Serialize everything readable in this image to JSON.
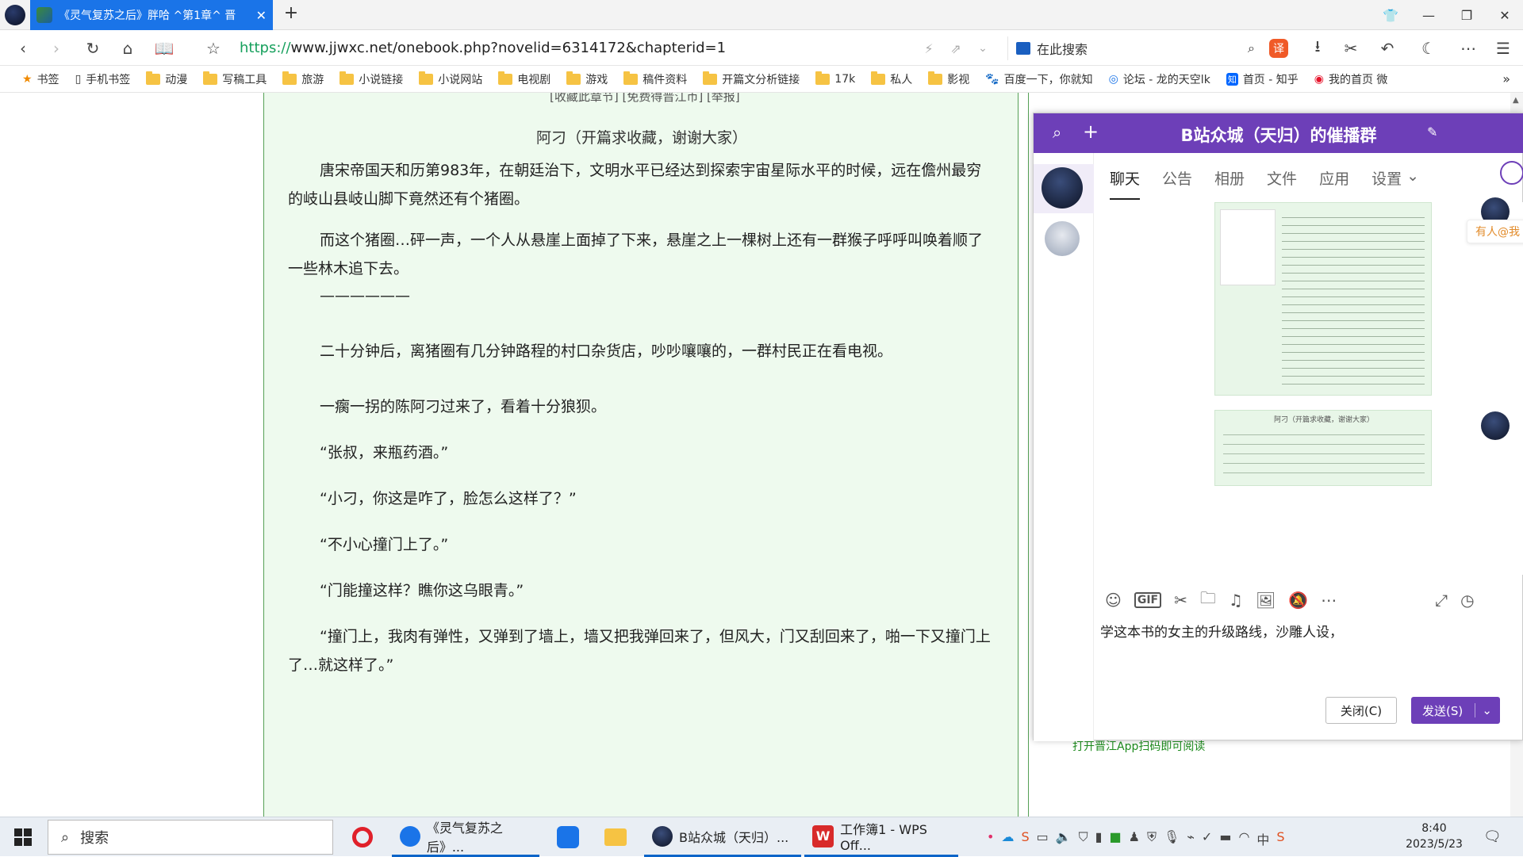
{
  "browser": {
    "tab_title": "《灵气复苏之后》胖哈  ^第1章^ 晋",
    "new_tab": "+",
    "url_https": "https://",
    "url_rest": "www.jjwxc.net/onebook.php?novelid=6314172&chapterid=1",
    "search_placeholder": "在此搜索"
  },
  "bookmarks": [
    {
      "label": "书签",
      "icon": "star-icon"
    },
    {
      "label": "手机书签",
      "icon": "phone-icon"
    },
    {
      "label": "动漫",
      "icon": "folder-icon"
    },
    {
      "label": "写稿工具",
      "icon": "folder-icon"
    },
    {
      "label": "旅游",
      "icon": "folder-icon"
    },
    {
      "label": "小说链接",
      "icon": "folder-icon"
    },
    {
      "label": "小说网站",
      "icon": "folder-icon"
    },
    {
      "label": "电视剧",
      "icon": "folder-icon"
    },
    {
      "label": "游戏",
      "icon": "folder-icon"
    },
    {
      "label": "稿件资料",
      "icon": "folder-icon"
    },
    {
      "label": "开篇文分析链接",
      "icon": "folder-icon"
    },
    {
      "label": "17k",
      "icon": "folder-icon"
    },
    {
      "label": "私人",
      "icon": "folder-icon"
    },
    {
      "label": "影视",
      "icon": "folder-icon"
    },
    {
      "label": "百度一下，你就知",
      "icon": "baidu-icon"
    },
    {
      "label": "论坛 - 龙的天空lk",
      "icon": "forum-icon"
    },
    {
      "label": "首页 - 知乎",
      "icon": "zhihu-icon"
    },
    {
      "label": "我的首页 微",
      "icon": "weibo-icon"
    }
  ],
  "article": {
    "top_links": "[收藏此章节] [免费得晋江币] [举报]",
    "title": "阿刁（开篇求收藏，谢谢大家）",
    "paragraphs": [
      "唐宋帝国天和历第983年，在朝廷治下，文明水平已经达到探索宇宙星际水平的时候，远在儋州最穷的岐山县岐山脚下竟然还有个猪圈。",
      "而这个猪圈…砰一声，一个人从悬崖上面掉了下来，悬崖之上一棵树上还有一群猴子呼呼叫唤着顺了一些林木追下去。",
      "——————",
      "二十分钟后，离猪圈有几分钟路程的村口杂货店，吵吵嚷嚷的，一群村民正在看电视。",
      "一瘸一拐的陈阿刁过来了，看着十分狼狈。",
      "“张叔，来瓶药酒。”",
      "“小刁，你这是咋了，脸怎么这样了？”",
      "“不小心撞门上了。”",
      "“门能撞这样？瞧你这乌眼青。”",
      "“撞门上，我肉有弹性，又弹到了墙上，墙又把我弹回来了，但风大，门又刮回来了，啪一下又撞门上了…就这样了。”"
    ],
    "side_text": "打开晋江App扫码即可阅读"
  },
  "chat": {
    "title": "B站众城（天归）的催播群",
    "tabs": [
      "聊天",
      "公告",
      "相册",
      "文件",
      "应用",
      "设置"
    ],
    "at_me": "有人@我",
    "shot2_title": "阿刁（开篇求收藏，谢谢大家）",
    "input_text": "学这本书的女主的升级路线，沙雕人设，",
    "close_label": "关闭(C)",
    "send_label": "发送(S)",
    "accent": "#6d3fb8"
  },
  "taskbar": {
    "search": "搜索",
    "tasks": [
      {
        "label": "《灵气复苏之后》..."
      },
      {
        "label": "B站众城（天归）..."
      },
      {
        "label": "工作簿1 - WPS Off..."
      }
    ],
    "time": "8:40",
    "date": "2023/5/23"
  }
}
